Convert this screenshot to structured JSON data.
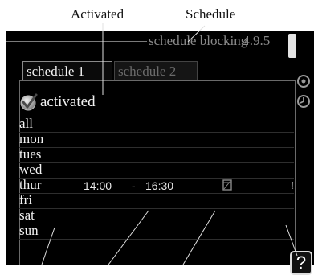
{
  "callouts": {
    "activated": "Activated",
    "schedule": "Schedule"
  },
  "screen": {
    "title": "schedule blocking",
    "page_number": "4.9.5"
  },
  "tabs": [
    {
      "label": "schedule 1",
      "active": true
    },
    {
      "label": "schedule 2",
      "active": false
    }
  ],
  "activated": {
    "label": "activated",
    "checked": true
  },
  "days": [
    {
      "label": "all"
    },
    {
      "label": "mon"
    },
    {
      "label": "tues"
    },
    {
      "label": "wed"
    },
    {
      "label": "thur",
      "start": "14:00",
      "separator": "-",
      "end": "16:30",
      "conflict_icon": "compressor-block-icon",
      "conflict_marker": "!"
    },
    {
      "label": "fri"
    },
    {
      "label": "sat"
    },
    {
      "label": "sun"
    }
  ],
  "icons": {
    "side": [
      "settings-icon",
      "clock-icon"
    ],
    "help": "?"
  },
  "colors": {
    "screen_bg": "#000000",
    "text": "#f2f2f2",
    "dim": "#8a8a8a"
  }
}
